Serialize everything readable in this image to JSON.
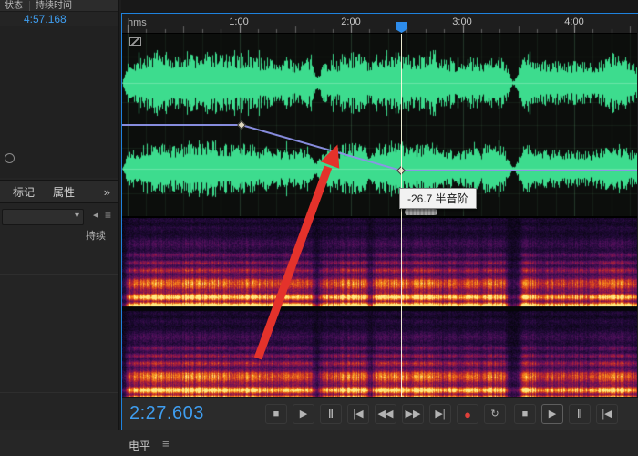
{
  "colors": {
    "accent_blue": "#2d8ceb",
    "waveform_green": "#3ddc8e",
    "envelope_purple": "#8d92e8",
    "record_red": "#e0403a",
    "time_blue": "#3f9ef0",
    "playhead_white": "#fffce1",
    "annotation_red": "#e4322b"
  },
  "left_panel": {
    "header": {
      "col1": "状态",
      "col2": "持续时间"
    },
    "duration_value": "4:57.168",
    "tabs": {
      "marker": "标记",
      "properties": "属性",
      "overflow": "»"
    },
    "dropdown": {
      "value": "",
      "chevron": "▾"
    },
    "side_icons": {
      "collapse": "◄",
      "menu": "≡"
    },
    "column_header": "持续"
  },
  "ruler": {
    "unit": "hms",
    "ticks": [
      "1:00",
      "2:00",
      "3:00",
      "4:00"
    ]
  },
  "envelope": {
    "tooltip": "-26.7 半音阶"
  },
  "transport": {
    "time": "2:27.603",
    "left_buttons": [
      {
        "name": "stop",
        "glyph": "■"
      },
      {
        "name": "play",
        "glyph": "▶"
      },
      {
        "name": "pause",
        "glyph": "‖"
      },
      {
        "name": "skip-to-start",
        "glyph": "|◀"
      },
      {
        "name": "rewind",
        "glyph": "◀◀"
      },
      {
        "name": "fast-forward",
        "glyph": "▶▶"
      },
      {
        "name": "skip-to-end",
        "glyph": "▶|"
      },
      {
        "name": "record",
        "glyph": "●"
      },
      {
        "name": "loop",
        "glyph": "↻"
      }
    ],
    "right_buttons": [
      {
        "name": "stop-2",
        "glyph": "■"
      },
      {
        "name": "play-2",
        "glyph": "▶"
      },
      {
        "name": "pause-2",
        "glyph": "‖"
      },
      {
        "name": "skip-to-start-2",
        "glyph": "|◀"
      }
    ]
  },
  "bottom_panel": {
    "title": "电平",
    "menu_glyph": "≡"
  }
}
